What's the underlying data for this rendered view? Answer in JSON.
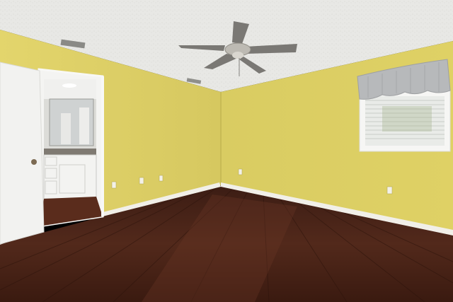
{
  "scene": {
    "description_type": "interior-photo",
    "colors": {
      "ceiling": "#e9e9e6",
      "wall_left": "#dccf6a",
      "wall_right": "#dccf5a",
      "baseboard": "#f1efe8",
      "floor": "#4a2519",
      "door": "#f2f2f0",
      "fan_blade": "#7a7874",
      "fan_body": "#bdbab3",
      "valance": "#b7b9bb",
      "window_frame": "#f6f6f4",
      "bath_cabinet": "#f3f3f1",
      "countertop": "#7f7a72"
    }
  }
}
